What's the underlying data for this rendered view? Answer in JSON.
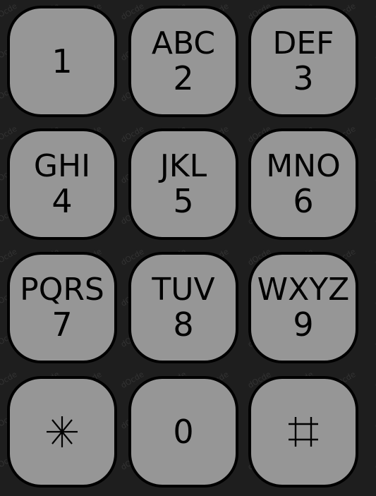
{
  "keypad": {
    "keys": [
      {
        "letters": "",
        "digit": "1"
      },
      {
        "letters": "ABC",
        "digit": "2"
      },
      {
        "letters": "DEF",
        "digit": "3"
      },
      {
        "letters": "GHI",
        "digit": "4"
      },
      {
        "letters": "JKL",
        "digit": "5"
      },
      {
        "letters": "MNO",
        "digit": "6"
      },
      {
        "letters": "PQRS",
        "digit": "7"
      },
      {
        "letters": "TUV",
        "digit": "8"
      },
      {
        "letters": "WXYZ",
        "digit": "9"
      },
      {
        "letters": "",
        "digit": "",
        "icon": "asterisk-icon"
      },
      {
        "letters": "",
        "digit": "0"
      },
      {
        "letters": "",
        "digit": "",
        "icon": "hash-icon"
      }
    ],
    "watermark_text": "dOcde",
    "colors": {
      "background": "#1e1e1e",
      "key_fill": "#969696",
      "key_border": "#000000",
      "text": "#000000"
    }
  }
}
